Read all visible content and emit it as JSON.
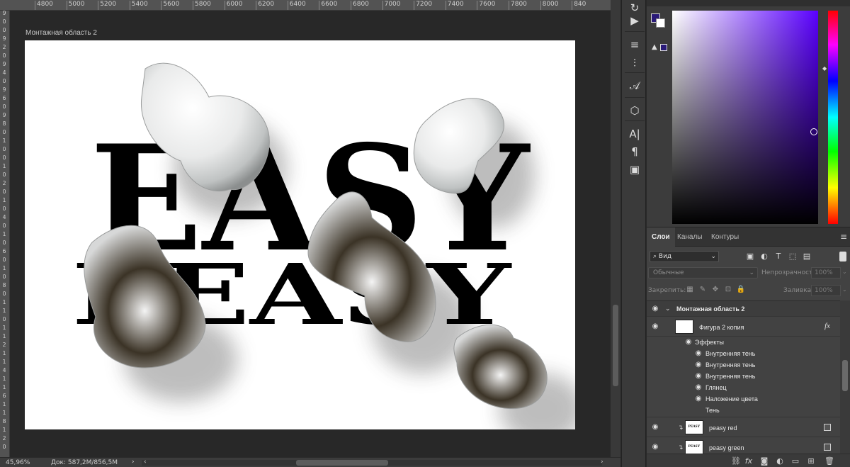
{
  "ruler_top": [
    "4800",
    "5000",
    "5200",
    "5400",
    "5600",
    "5800",
    "6000",
    "6200",
    "6400",
    "6600",
    "6800",
    "7000",
    "7200",
    "7400",
    "7600",
    "7800",
    "8000",
    "840"
  ],
  "ruler_left": [
    "9",
    "0",
    "0",
    "9",
    "2",
    "0",
    "9",
    "4",
    "0",
    "9",
    "6",
    "0",
    "9",
    "8",
    "0",
    "1",
    "0",
    "0",
    "1",
    "0",
    "2",
    "0",
    "1",
    "0",
    "4",
    "0",
    "1",
    "0",
    "6",
    "0",
    "1",
    "0",
    "8",
    "0",
    "1",
    "1",
    "0",
    "1",
    "1",
    "2",
    "1",
    "1",
    "4",
    "1",
    "1",
    "6",
    "1",
    "1",
    "8",
    "1",
    "2",
    "0"
  ],
  "artboard": {
    "label": "Монтажная область 2",
    "line1": "EASY",
    "line2": "PEASY"
  },
  "status": {
    "zoom": "45,96%",
    "doc": "Док: 587,2M/856,5M",
    "arrow": "›"
  },
  "tools": [
    {
      "icon": "history-brush-icon",
      "glyph": "↻"
    },
    {
      "icon": "play-icon",
      "glyph": "▶"
    },
    {
      "icon": "brush-settings-icon",
      "glyph": "≡"
    },
    {
      "icon": "adjustments-icon",
      "glyph": "⫶"
    },
    {
      "icon": "glyph-panel-icon",
      "glyph": "𝒜"
    },
    {
      "icon": "3d-cube-icon",
      "glyph": "⬡"
    },
    {
      "icon": "character-icon",
      "glyph": "A|"
    },
    {
      "icon": "paragraph-icon",
      "glyph": "¶"
    },
    {
      "icon": "properties-icon",
      "glyph": "▣"
    }
  ],
  "colors": {
    "foreground": "#2a1a78",
    "background": "#ffffff",
    "hue": "#5a00ff"
  },
  "layers_panel": {
    "tabs": [
      "Слои",
      "Каналы",
      "Контуры"
    ],
    "kind_filter": "Вид",
    "blend_mode": "Обычные",
    "opacity_label": "Непрозрачность:",
    "opacity_value": "100%",
    "lock_label": "Закрепить:",
    "fill_label": "Заливка:",
    "fill_value": "100%",
    "artboard_group": "Монтажная область 2",
    "layers": [
      {
        "name": "Фигура 2 копия",
        "fx": "fx"
      },
      {
        "name": "peasy red",
        "thumb": "PEASY"
      },
      {
        "name": "peasy green",
        "thumb": "PEASY"
      }
    ],
    "effects_label": "Эффекты",
    "effects": [
      "Внутренняя тень",
      "Внутренняя тень",
      "Внутренняя тень",
      "Глянец",
      "Наложение цвета",
      "Тень"
    ],
    "footer_icons": [
      "link-icon",
      "fx-icon",
      "mask-icon",
      "adjustment-layer-icon",
      "group-folder-icon",
      "new-layer-icon",
      "trash-icon"
    ]
  }
}
